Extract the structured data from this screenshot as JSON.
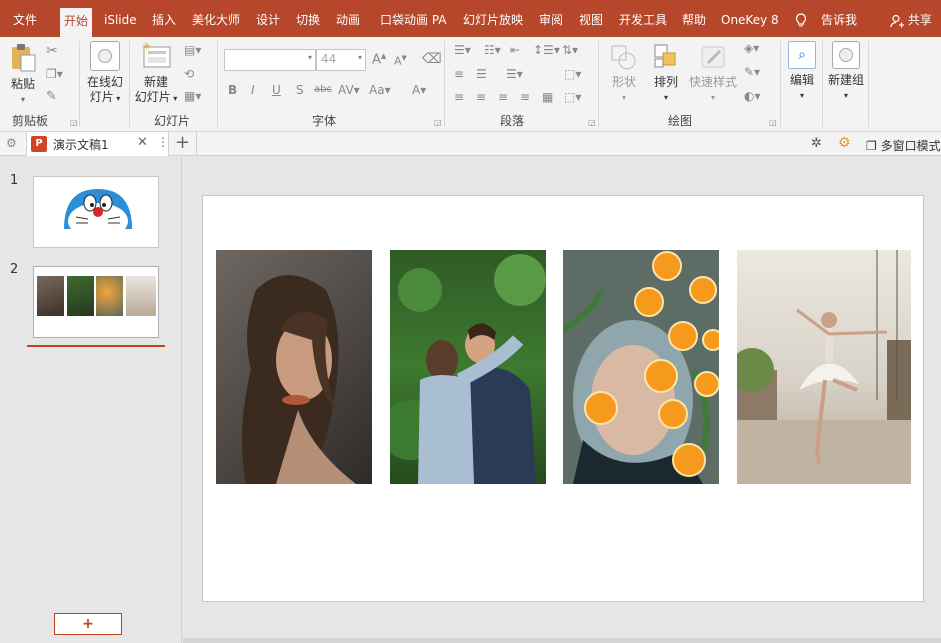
{
  "menu": {
    "tabs": [
      "文件",
      "开始",
      "iSlide",
      "插入",
      "美化大师",
      "设计",
      "切换",
      "动画",
      "口袋动画 PA",
      "幻灯片放映",
      "审阅",
      "视图",
      "开发工具",
      "帮助",
      "OneKey 8"
    ],
    "tell_me": "告诉我",
    "share": "共享"
  },
  "ribbon": {
    "paste": "粘贴",
    "online_slides_1": "在线幻",
    "online_slides_2": "灯片",
    "new_slide_1": "新建",
    "new_slide_2": "幻灯片",
    "font_size": "44",
    "shape": "形状",
    "arrange": "排列",
    "quick_styles": "快速样式",
    "edit": "编辑",
    "new_group": "新建组",
    "groups": {
      "clipboard": "剪贴板",
      "slides": "幻灯片",
      "font": "字体",
      "paragraph": "段落",
      "drawing": "绘图"
    }
  },
  "document": {
    "tab_title": "演示文稿1",
    "multi_window": "多窗口模式"
  },
  "thumbnails": {
    "slide1_number": "1",
    "slide2_number": "2",
    "add_label": "+"
  },
  "colors": {
    "accent": "#b7472a",
    "ribbon_bg": "#f3f3f3",
    "workspace_bg": "#e6e6e6"
  }
}
